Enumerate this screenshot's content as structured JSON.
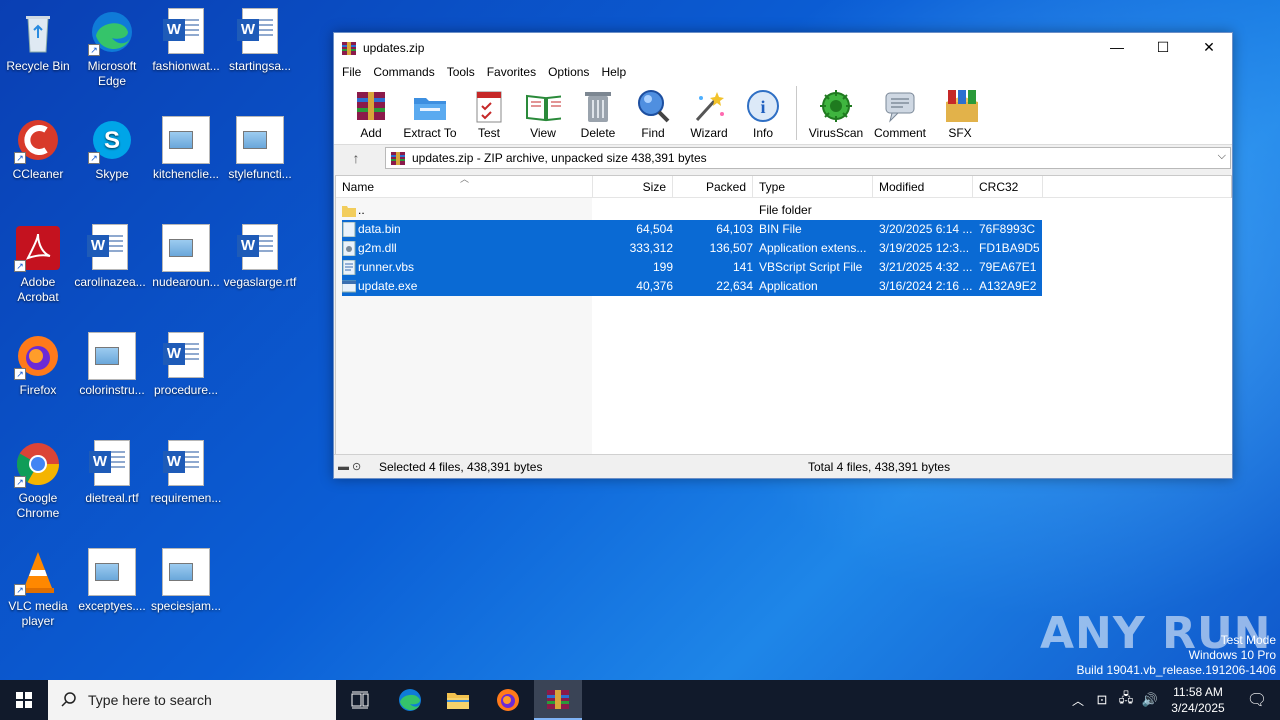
{
  "desktop": {
    "icons": [
      {
        "label": "Recycle Bin"
      },
      {
        "label": "Microsoft Edge"
      },
      {
        "label": "fashionwat..."
      },
      {
        "label": "startingsa..."
      },
      {
        "label": "CCleaner"
      },
      {
        "label": "Skype"
      },
      {
        "label": "kitchenclie..."
      },
      {
        "label": "stylefuncti..."
      },
      {
        "label": "Adobe Acrobat"
      },
      {
        "label": "carolinazea..."
      },
      {
        "label": "nudearoun..."
      },
      {
        "label": "vegaslarge.rtf"
      },
      {
        "label": "Firefox"
      },
      {
        "label": "colorinstru..."
      },
      {
        "label": "procedure..."
      },
      {
        "label": "Google Chrome"
      },
      {
        "label": "dietreal.rtf"
      },
      {
        "label": "requiremen..."
      },
      {
        "label": "VLC media player"
      },
      {
        "label": "exceptyes...."
      },
      {
        "label": "speciesjam..."
      }
    ]
  },
  "window": {
    "title": "updates.zip",
    "controls": {
      "minimize": "—",
      "maximize": "☐",
      "close": "✕"
    },
    "menu": [
      "File",
      "Commands",
      "Tools",
      "Favorites",
      "Options",
      "Help"
    ],
    "toolbar": [
      {
        "label": "Add",
        "icon": "add-icon"
      },
      {
        "label": "Extract To",
        "icon": "extract-icon"
      },
      {
        "label": "Test",
        "icon": "test-icon"
      },
      {
        "label": "View",
        "icon": "view-icon"
      },
      {
        "label": "Delete",
        "icon": "delete-icon"
      },
      {
        "label": "Find",
        "icon": "find-icon"
      },
      {
        "label": "Wizard",
        "icon": "wizard-icon"
      },
      {
        "label": "Info",
        "icon": "info-icon"
      },
      {
        "label": "VirusScan",
        "icon": "virusscan-icon"
      },
      {
        "label": "Comment",
        "icon": "comment-icon"
      },
      {
        "label": "SFX",
        "icon": "sfx-icon"
      }
    ],
    "address": "updates.zip - ZIP archive, unpacked size 438,391 bytes",
    "columns": [
      "Name",
      "Size",
      "Packed",
      "Type",
      "Modified",
      "CRC32"
    ],
    "rows": [
      {
        "name": "..",
        "size": "",
        "packed": "",
        "type": "File folder",
        "modified": "",
        "crc": "",
        "selected": false
      },
      {
        "name": "data.bin",
        "size": "64,504",
        "packed": "64,103",
        "type": "BIN File",
        "modified": "3/20/2025 6:14 ...",
        "crc": "76F8993C",
        "selected": true
      },
      {
        "name": "g2m.dll",
        "size": "333,312",
        "packed": "136,507",
        "type": "Application extens...",
        "modified": "3/19/2025 12:3...",
        "crc": "FD1BA9D5",
        "selected": true
      },
      {
        "name": "runner.vbs",
        "size": "199",
        "packed": "141",
        "type": "VBScript Script File",
        "modified": "3/21/2025 4:32 ...",
        "crc": "79EA67E1",
        "selected": true
      },
      {
        "name": "update.exe",
        "size": "40,376",
        "packed": "22,634",
        "type": "Application",
        "modified": "3/16/2024 2:16 ...",
        "crc": "A132A9E2",
        "selected": true
      }
    ],
    "status_left": "Selected 4 files, 438,391 bytes",
    "status_right": "Total 4 files, 438,391 bytes"
  },
  "taskbar": {
    "search_placeholder": "Type here to search",
    "time": "11:58 AM",
    "date": "3/24/2025"
  },
  "watermark": {
    "brand": "ANY RUN",
    "line1": "Test Mode",
    "line2": "Windows 10 Pro",
    "line3": "Build 19041.vb_release.191206-1406"
  },
  "colors": {
    "selection": "#0a6ad4",
    "taskbar": "#111a2b",
    "desktop": "#0b5fd6"
  }
}
